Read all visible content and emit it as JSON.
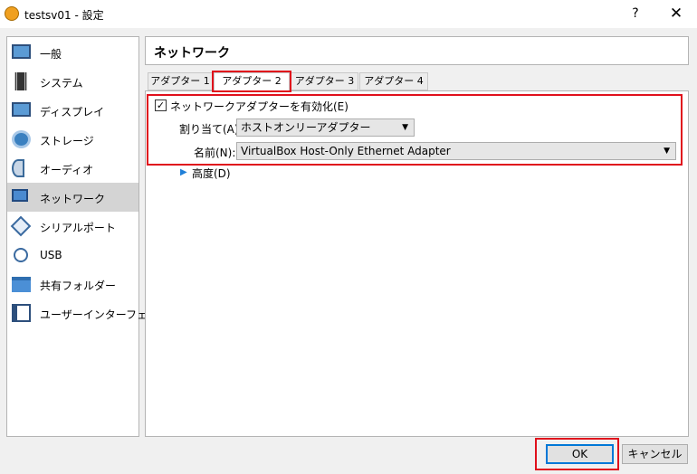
{
  "window": {
    "title": "testsv01 - 設定",
    "help_label": "?",
    "close_label": "✕"
  },
  "sidebar": {
    "items": [
      {
        "label": "一般",
        "icon": "general-icon"
      },
      {
        "label": "システム",
        "icon": "system-icon"
      },
      {
        "label": "ディスプレイ",
        "icon": "display-icon"
      },
      {
        "label": "ストレージ",
        "icon": "storage-icon"
      },
      {
        "label": "オーディオ",
        "icon": "audio-icon"
      },
      {
        "label": "ネットワーク",
        "icon": "network-icon"
      },
      {
        "label": "シリアルポート",
        "icon": "serial-port-icon"
      },
      {
        "label": "USB",
        "icon": "usb-icon"
      },
      {
        "label": "共有フォルダー",
        "icon": "shared-folder-icon"
      },
      {
        "label": "ユーザーインターフェース",
        "icon": "user-interface-icon"
      }
    ],
    "selected": "ネットワーク"
  },
  "page": {
    "title": "ネットワーク"
  },
  "tabs": [
    "アダプター 1",
    "アダプター 2",
    "アダプター 3",
    "アダプター 4"
  ],
  "active_tab": "アダプター 2",
  "adapter": {
    "enable_label": "ネットワークアダプターを有効化(E)",
    "enabled": true,
    "attached_label": "割り当て(A):",
    "attached_value": "ホストオンリーアダプター",
    "name_label": "名前(N):",
    "name_value": "VirtualBox Host-Only Ethernet Adapter",
    "advanced_label": "高度(D)"
  },
  "buttons": {
    "ok": "OK",
    "cancel": "キャンセル"
  },
  "colors": {
    "highlight": "#e0101c",
    "selected_bg": "#d4d4d4",
    "accent": "#0078d7"
  }
}
